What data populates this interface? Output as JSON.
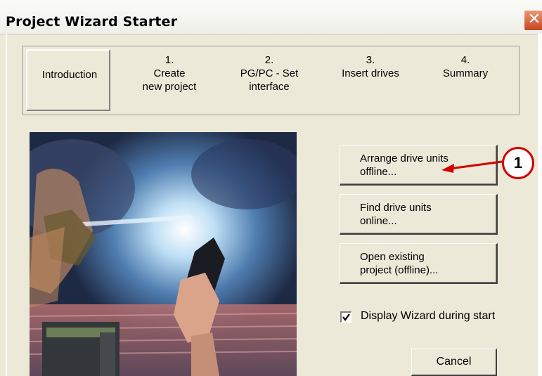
{
  "window": {
    "title": "Project Wizard Starter",
    "close_glyph": "✕"
  },
  "steps": [
    {
      "label": "Introduction"
    },
    {
      "label": "1.\nCreate\nnew project"
    },
    {
      "label": "2.\nPG/PC - Set\ninterface"
    },
    {
      "label": "3.\nInsert drives"
    },
    {
      "label": "4.\nSummary"
    }
  ],
  "actions": {
    "arrange": "Arrange drive units\noffline...",
    "find": "Find drive units\nonline...",
    "open": "Open existing\nproject (offline)..."
  },
  "options": {
    "display_wizard_label": "Display Wizard during start",
    "display_wizard_checked": true
  },
  "cancel_label": "Cancel",
  "callout": {
    "number": "1",
    "color": "#d40000"
  }
}
